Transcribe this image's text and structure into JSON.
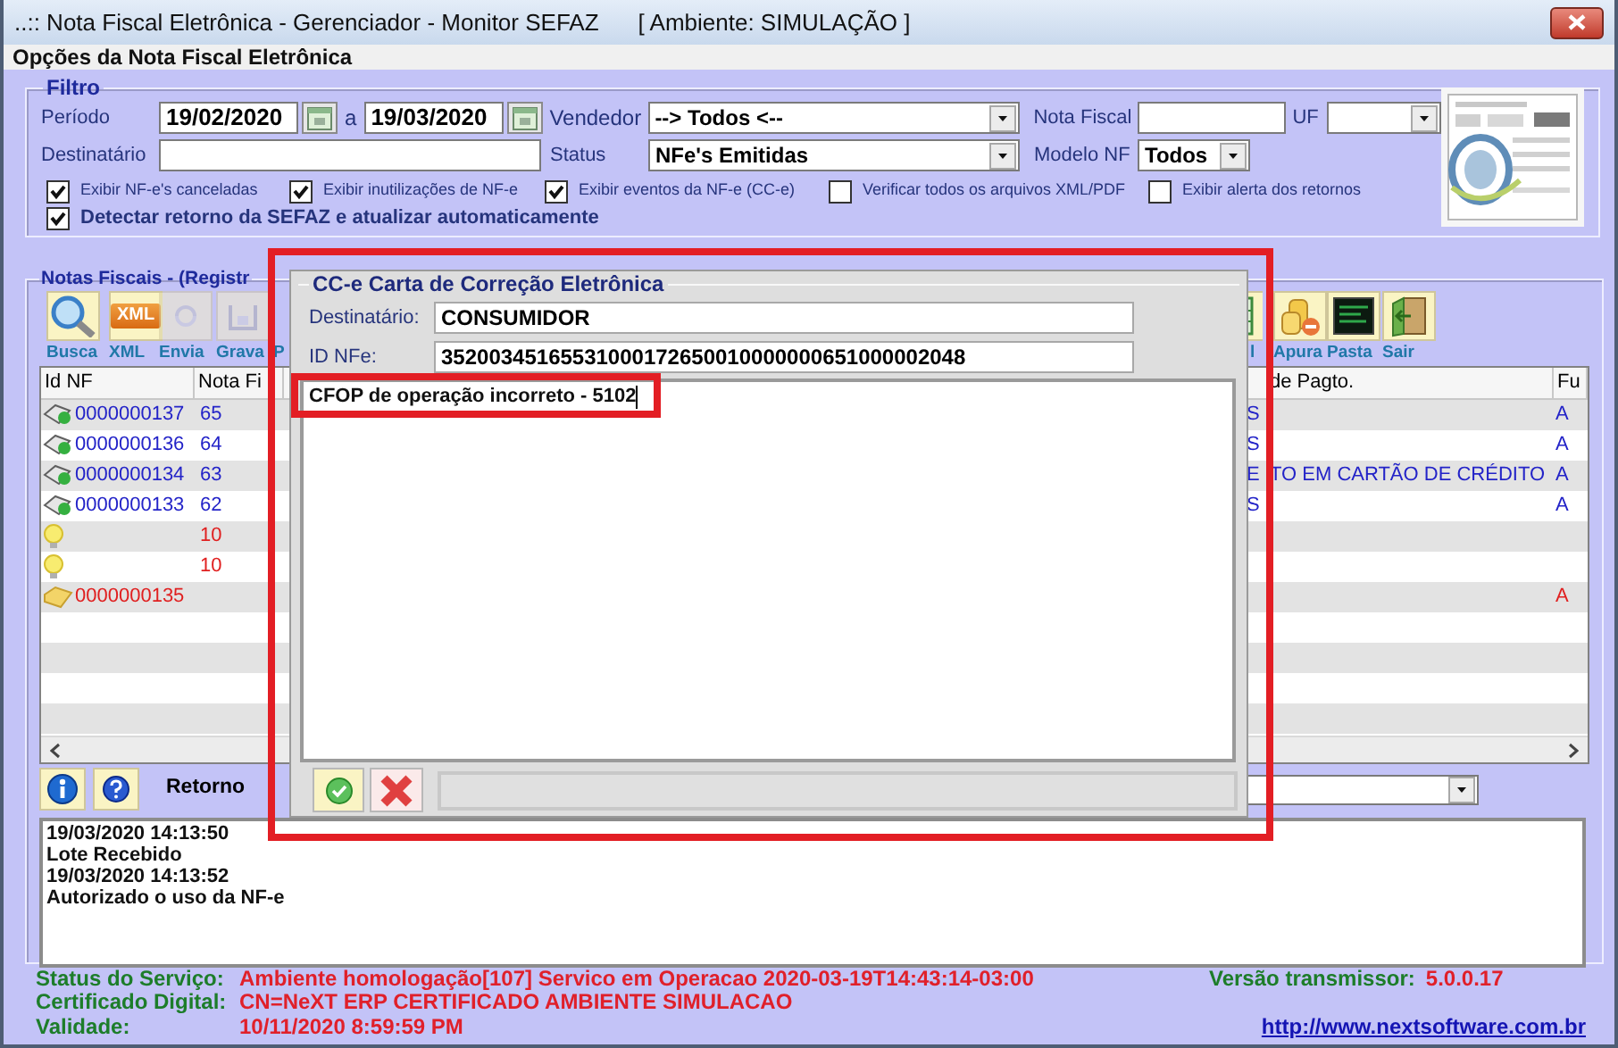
{
  "window": {
    "title": "..:: Nota Fiscal Eletrônica - Gerenciador - Monitor SEFAZ",
    "environment": "[ Ambiente: SIMULAÇÃO ]"
  },
  "header": "Opções da Nota Fiscal Eletrônica",
  "filter": {
    "title": "Filtro",
    "periodo": {
      "label": "Período",
      "from": "19/02/2020",
      "connector": "a",
      "to": "19/03/2020"
    },
    "vendedor": {
      "label": "Vendedor",
      "value": "--> Todos <--"
    },
    "nota_fiscal": {
      "label": "Nota Fiscal"
    },
    "uf": {
      "label": "UF"
    },
    "destinatario": {
      "label": "Destinatário"
    },
    "status": {
      "label": "Status",
      "value": "NFe's Emitidas"
    },
    "modelo_nf": {
      "label": "Modelo NF",
      "value": "Todos"
    },
    "checkboxes": [
      {
        "label": "Exibir NF-e's canceladas",
        "checked": true
      },
      {
        "label": "Exibir inutilizações de NF-e",
        "checked": true
      },
      {
        "label": "Exibir eventos da NF-e (CC-e)",
        "checked": true
      },
      {
        "label": "Verificar todos os arquivos XML/PDF",
        "checked": false
      },
      {
        "label": "Exibir alerta dos retornos",
        "checked": false
      }
    ],
    "auto_detect": {
      "label": "Detectar retorno da SEFAZ e atualizar automaticamente",
      "checked": true
    }
  },
  "notas": {
    "title": "Notas Fiscais - (Registr",
    "toolbar_left": [
      {
        "kind": "search",
        "label": "Busca",
        "disabled": false
      },
      {
        "kind": "xml",
        "badge": "XML",
        "label": "XML",
        "disabled": false
      },
      {
        "kind": "arrows",
        "label": "Envia",
        "disabled": true
      },
      {
        "kind": "save",
        "label": "Grava",
        "disabled": true
      },
      {
        "kind": "hidden",
        "label": "P"
      }
    ],
    "toolbar_right": [
      {
        "kind": "sheet",
        "label": "l"
      },
      {
        "kind": "coins",
        "label": "Apura",
        "disabled": false
      },
      {
        "kind": "monitor",
        "label": "Pasta",
        "disabled": false
      },
      {
        "kind": "door",
        "label": "Sair",
        "disabled": false
      }
    ],
    "table": {
      "columns": [
        "Id NF",
        "Nota Fi",
        "de Pagto.",
        "Fu"
      ],
      "rows": [
        {
          "kind": "card",
          "id_nf": "0000000137",
          "nota_fiscal": "65",
          "pagto": "S",
          "column_4": "A",
          "color": "#2323c8"
        },
        {
          "kind": "card",
          "id_nf": "0000000136",
          "nota_fiscal": "64",
          "pagto": "S",
          "column_4": "A",
          "color": "#2323c8"
        },
        {
          "kind": "card",
          "id_nf": "0000000134",
          "nota_fiscal": "63",
          "pagto": "E",
          "pagto_continued": "TO EM CARTÃO DE CRÉDITO",
          "column_4": "A",
          "color": "#2323c8"
        },
        {
          "kind": "card",
          "id_nf": "0000000133",
          "nota_fiscal": "62",
          "pagto": "S",
          "column_4": "A",
          "color": "#2323c8"
        },
        {
          "kind": "bulb",
          "nota_fiscal": "10",
          "color": "#e02020"
        },
        {
          "kind": "bulb",
          "nota_fiscal": "10",
          "color": "#e02020"
        },
        {
          "kind": "folder",
          "id_nf": "0000000135",
          "column_4": "A",
          "color": "#e02020"
        }
      ]
    },
    "retorno_label": "Retorno",
    "log": [
      "19/03/2020 14:13:50",
      "Lote Recebido",
      "19/03/2020 14:13:52",
      "Autorizado o uso da NF-e"
    ]
  },
  "status_bar": {
    "lines": [
      {
        "label": "Status do Serviço:",
        "value": "Ambiente homologação[107] Servico em Operacao 2020-03-19T14:43:14-03:00"
      },
      {
        "label": "Certificado Digital:",
        "value": "CN=NeXT ERP CERTIFICADO AMBIENTE SIMULACAO"
      },
      {
        "label": "Validade:",
        "value": "10/11/2020 8:59:59 PM"
      }
    ],
    "version": {
      "label": "Versão transmissor:",
      "value": "5.0.0.17"
    },
    "link": "http://www.nextsoftware.com.br"
  },
  "dialog": {
    "title": "CC-e Carta de Correção Eletrônica",
    "fields": [
      {
        "label": "Destinatário:",
        "value": "CONSUMIDOR"
      },
      {
        "label": "ID NFe:",
        "value": "35200345165531000172650010000000651000002048"
      }
    ],
    "correction_text": "CFOP de operação incorreto - 5102"
  }
}
